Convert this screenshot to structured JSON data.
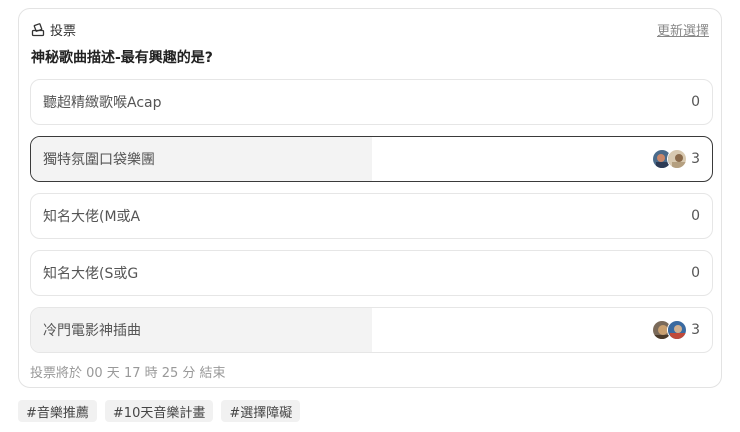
{
  "poll": {
    "label": "投票",
    "update_link": "更新選擇",
    "question": "神秘歌曲描述-最有興趣的是?",
    "options": [
      {
        "label": "聽超精緻歌喉Acap",
        "count": "0",
        "fill": 0,
        "selected": false,
        "avatars": []
      },
      {
        "label": "獨特氛圍口袋樂團",
        "count": "3",
        "fill": 0.5,
        "selected": true,
        "avatars": [
          "avatar-1",
          "avatar-2"
        ]
      },
      {
        "label": "知名大佬(M或A",
        "count": "0",
        "fill": 0,
        "selected": false,
        "avatars": []
      },
      {
        "label": "知名大佬(S或G",
        "count": "0",
        "fill": 0,
        "selected": false,
        "avatars": []
      },
      {
        "label": "冷門電影神插曲",
        "count": "3",
        "fill": 0.5,
        "selected": false,
        "avatars": [
          "avatar-3",
          "avatar-4"
        ]
      }
    ],
    "footer": "投票將於 00 天 17 時 25 分 結束"
  },
  "tags": [
    "#音樂推薦",
    "#10天音樂計畫",
    "#選擇障礙"
  ],
  "colors": {
    "border": "#e3e3e3",
    "selected_border": "#3a3a3a",
    "fill": "#f3f3f3",
    "muted": "#999999"
  }
}
